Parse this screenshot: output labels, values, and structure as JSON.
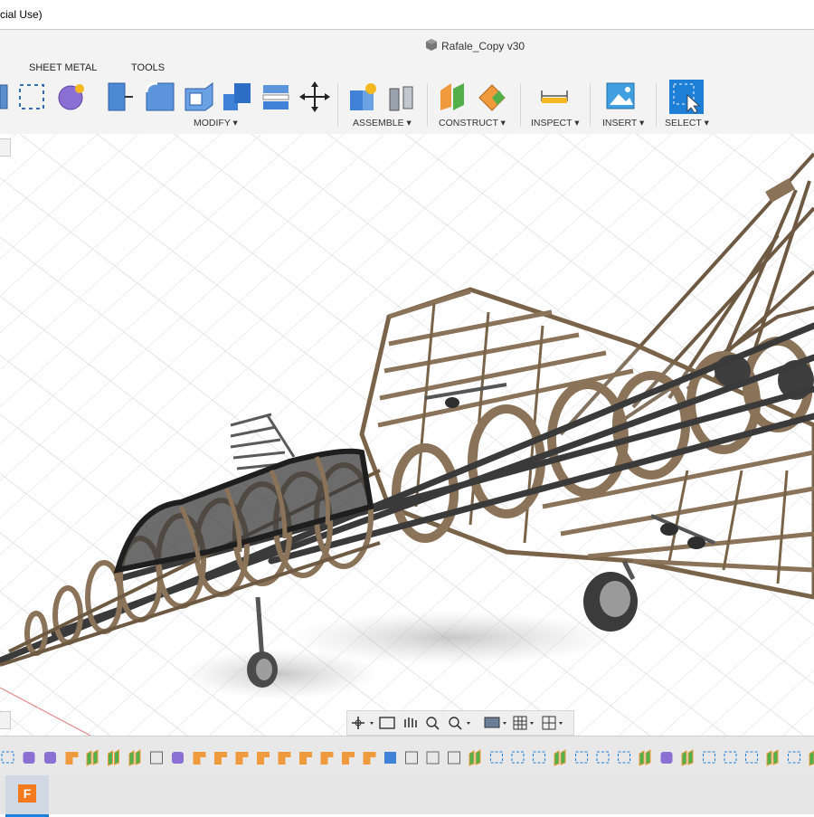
{
  "window": {
    "title_fragment": "cial Use)",
    "document_title": "Rafale_Copy v30"
  },
  "ribbon": {
    "tabs": [
      "SHEET METAL",
      "TOOLS"
    ],
    "groups": [
      {
        "label": "MODIFY ▾"
      },
      {
        "label": "ASSEMBLE ▾"
      },
      {
        "label": "CONSTRUCT ▾"
      },
      {
        "label": "INSPECT ▾"
      },
      {
        "label": "INSERT ▾"
      },
      {
        "label": "SELECT ▾"
      }
    ]
  },
  "colors": {
    "accent": "#1d7fd6",
    "wood": "#8a7358",
    "rod": "#3a3a3a"
  },
  "timeline": {
    "icon_count": 40
  }
}
